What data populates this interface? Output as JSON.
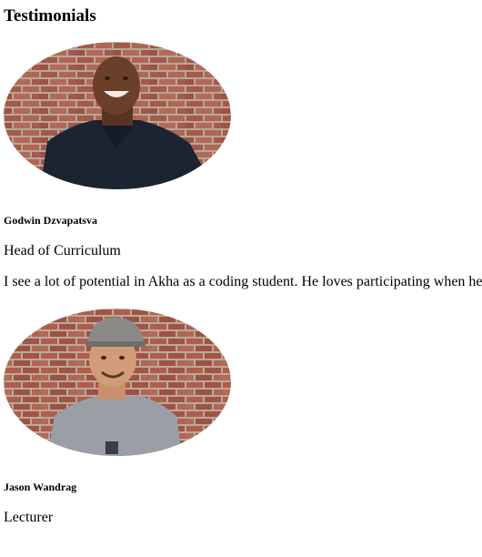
{
  "section": {
    "title": "Testimonials"
  },
  "testimonials": [
    {
      "name": "Godwin Dzvapatsva",
      "role": "Head of Curriculum",
      "quote": "I see a lot of potential in Akha as a coding student. He loves participating when he",
      "photo_icon": "person-photo"
    },
    {
      "name": "Jason Wandrag",
      "role": "Lecturer",
      "photo_icon": "person-photo"
    }
  ],
  "colors": {
    "brick": "#a45a48",
    "mortar": "#b9aaa0",
    "shirt_dark": "#1b2430",
    "shirt_grey": "#9a9fa6"
  }
}
